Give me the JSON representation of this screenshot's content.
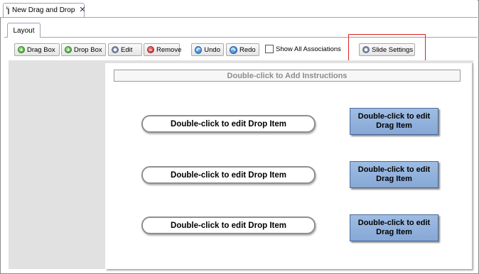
{
  "editor": {
    "tab_label": "New Drag and Drop"
  },
  "layout_tab": {
    "label": "Layout"
  },
  "toolbar": {
    "drag_box": "Drag Box",
    "drop_box": "Drop Box",
    "edit": "Edit",
    "remove": "Remove",
    "undo": "Undo",
    "redo": "Redo",
    "show_all_associations": "Show All Associations",
    "show_all_associations_checked": false,
    "slide_settings": "Slide Settings"
  },
  "slide": {
    "instructions": "Double-click to Add Instructions",
    "drop_items": [
      {
        "label": "Double-click to edit Drop Item"
      },
      {
        "label": "Double-click to edit Drop Item"
      },
      {
        "label": "Double-click to edit Drop Item"
      }
    ],
    "drag_items": [
      {
        "label": "Double-click to edit Drag Item"
      },
      {
        "label": "Double-click to edit Drag Item"
      },
      {
        "label": "Double-click to edit Drag Item"
      }
    ]
  },
  "colors": {
    "drag_item_fill": "#8fb0db",
    "highlight": "#e02020",
    "workspace": "#e1e1e1"
  },
  "icons": {
    "drag_box": "add-icon",
    "drop_box": "add-icon",
    "edit": "gear-icon",
    "remove": "remove-icon",
    "undo": "undo-icon",
    "redo": "redo-icon",
    "slide_settings": "gear-icon"
  }
}
